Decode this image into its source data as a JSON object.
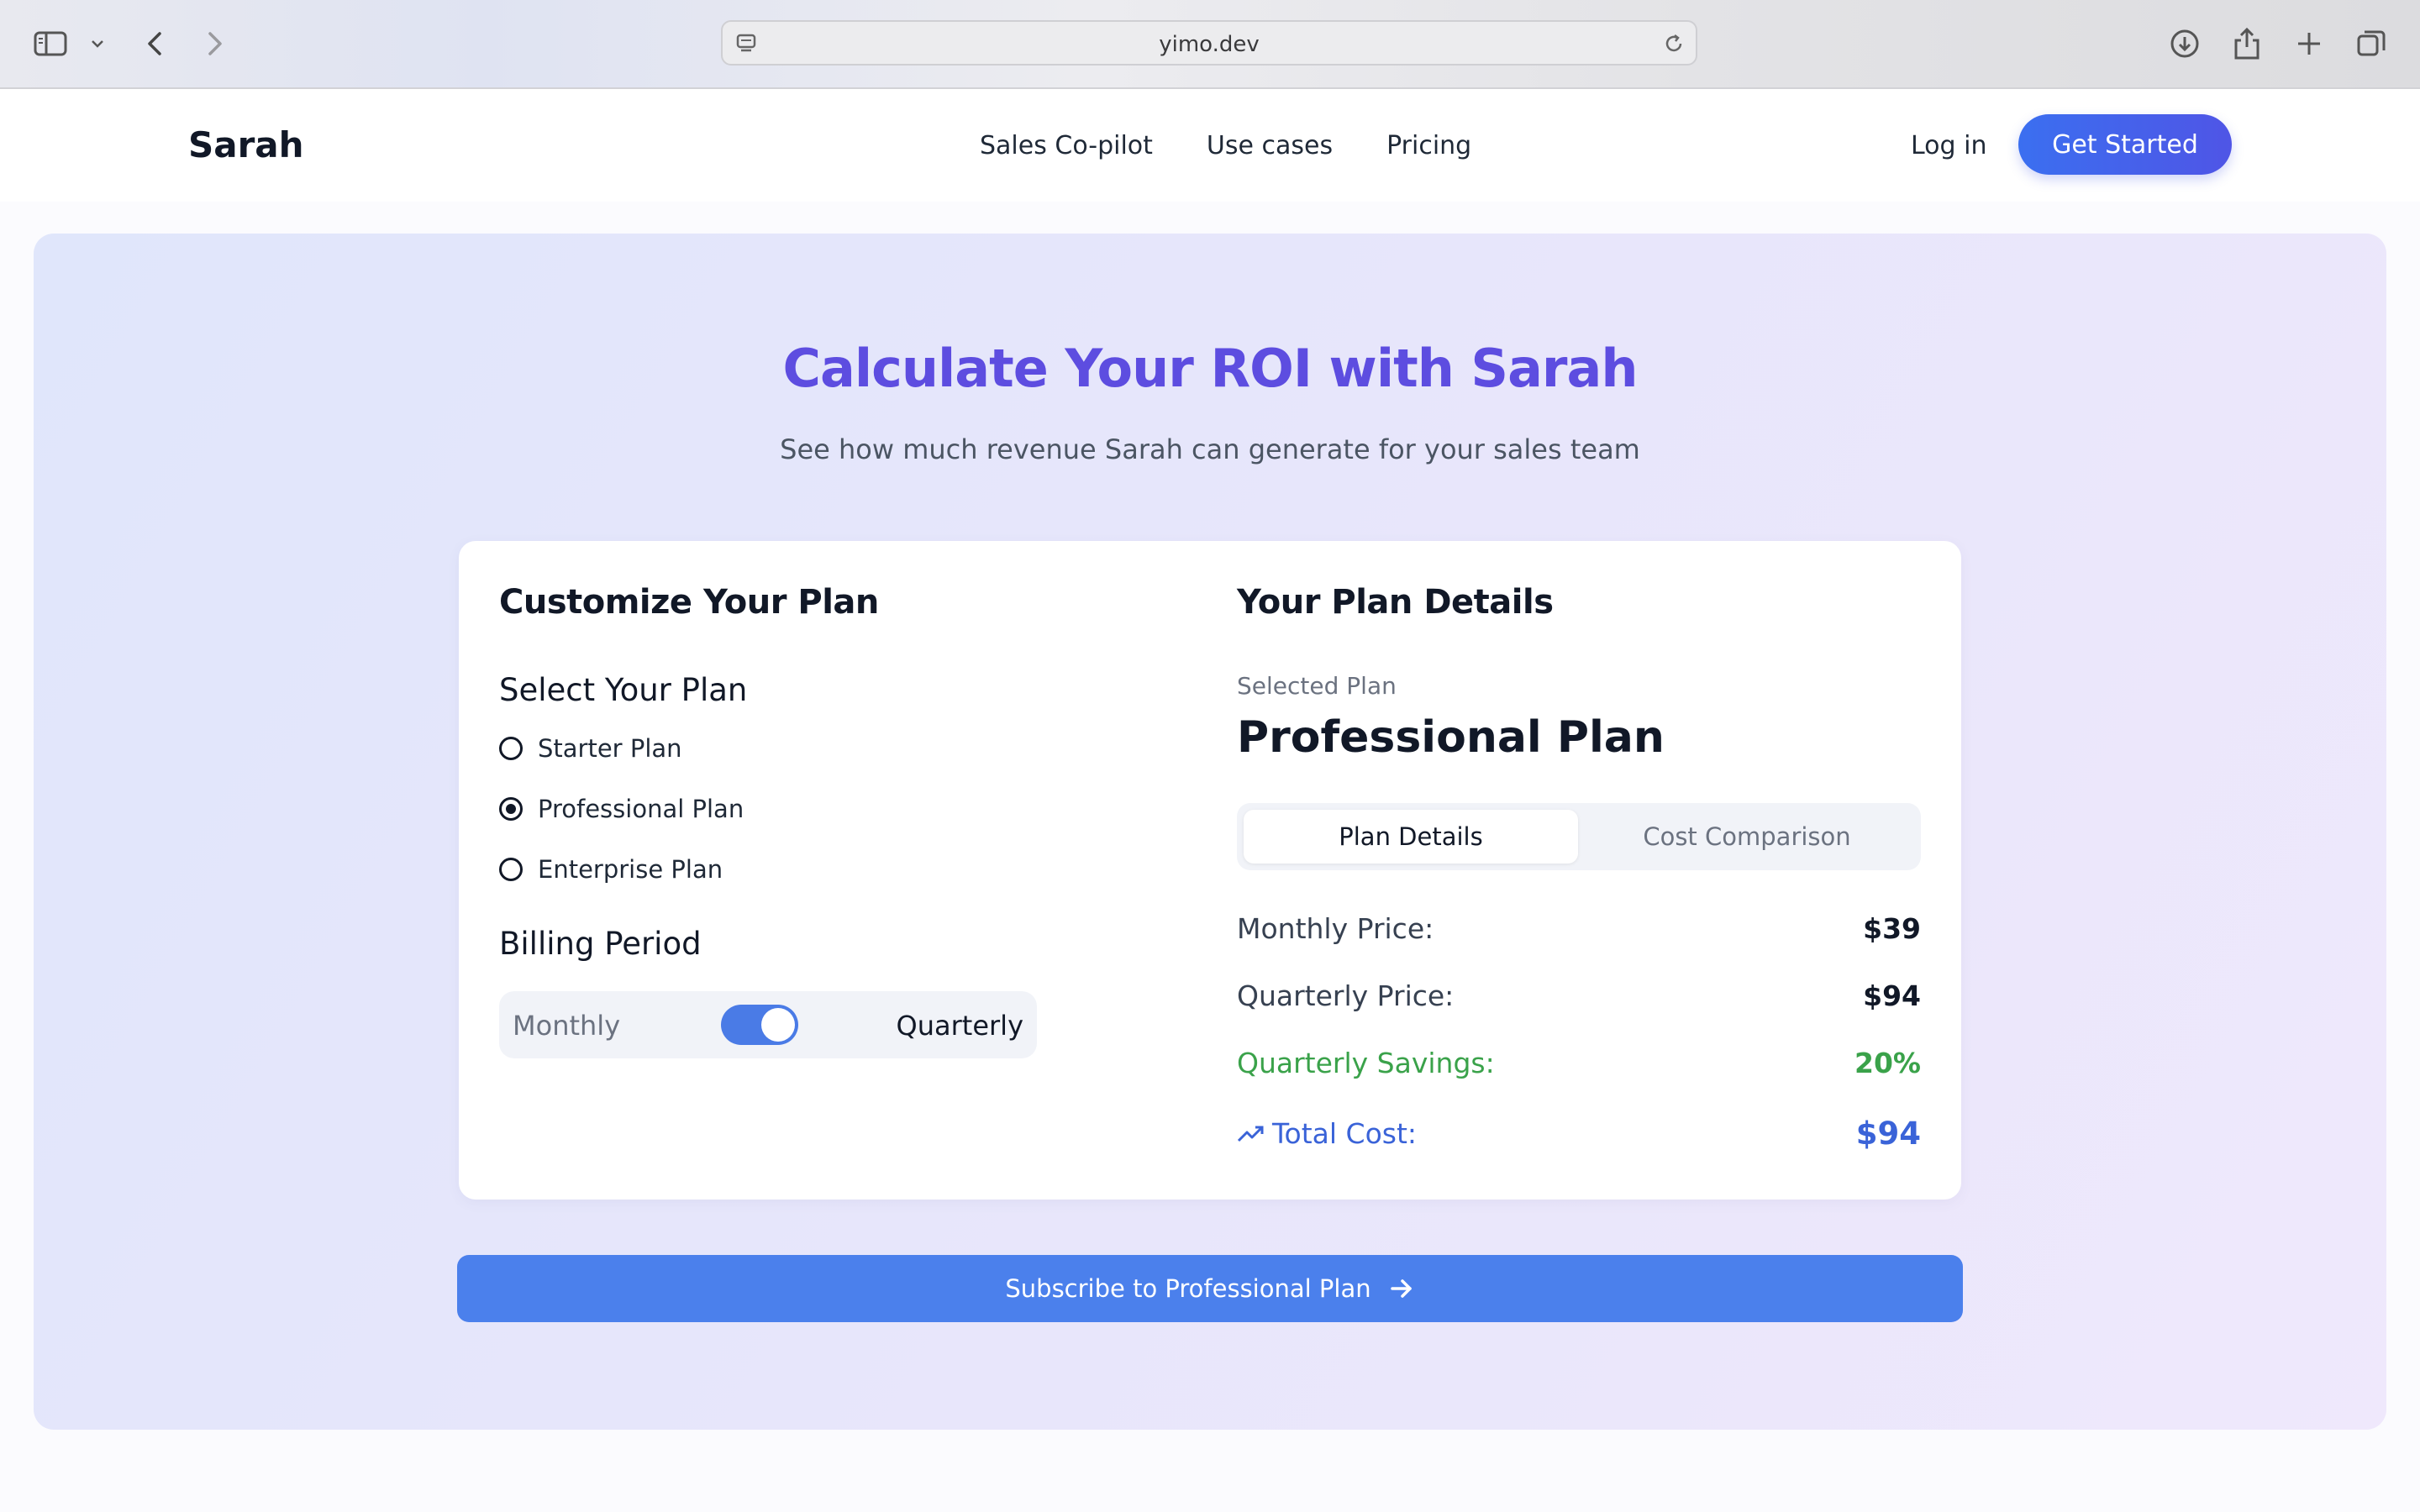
{
  "browser": {
    "url": "yimo.dev",
    "icons": [
      "sidebar-icon",
      "chevron-down-icon",
      "back-icon",
      "forward-icon",
      "site-settings-icon",
      "reload-icon",
      "download-icon",
      "share-icon",
      "new-tab-icon",
      "tabs-overview-icon"
    ]
  },
  "nav": {
    "brand": "Sarah",
    "links": [
      "Sales Co-pilot",
      "Use cases",
      "Pricing"
    ],
    "login": "Log in",
    "cta": "Get Started"
  },
  "hero": {
    "title": "Calculate Your ROI with Sarah",
    "subtitle": "See how much revenue Sarah can generate for your sales team"
  },
  "customize": {
    "title": "Customize Your Plan",
    "select_title": "Select Your Plan",
    "plans": [
      {
        "label": "Starter Plan",
        "selected": false
      },
      {
        "label": "Professional Plan",
        "selected": true
      },
      {
        "label": "Enterprise Plan",
        "selected": false
      }
    ],
    "billing_title": "Billing Period",
    "billing_monthly": "Monthly",
    "billing_quarterly": "Quarterly",
    "billing_toggle_on": true
  },
  "details": {
    "title": "Your Plan Details",
    "selected_label": "Selected Plan",
    "selected_plan": "Professional Plan",
    "tabs": [
      "Plan Details",
      "Cost Comparison"
    ],
    "active_tab": 0,
    "rows": [
      {
        "label": "Monthly Price:",
        "value": "$39"
      },
      {
        "label": "Quarterly Price:",
        "value": "$94"
      },
      {
        "label": "Quarterly Savings:",
        "value": "20%"
      },
      {
        "label": "Total Cost:",
        "value": "$94"
      }
    ]
  },
  "subscribe": {
    "label": "Subscribe to Professional Plan"
  },
  "colors": {
    "accent": "#4b80ec",
    "title": "#5d4de0",
    "savings": "#3aa24a",
    "total": "#3a63d8"
  }
}
